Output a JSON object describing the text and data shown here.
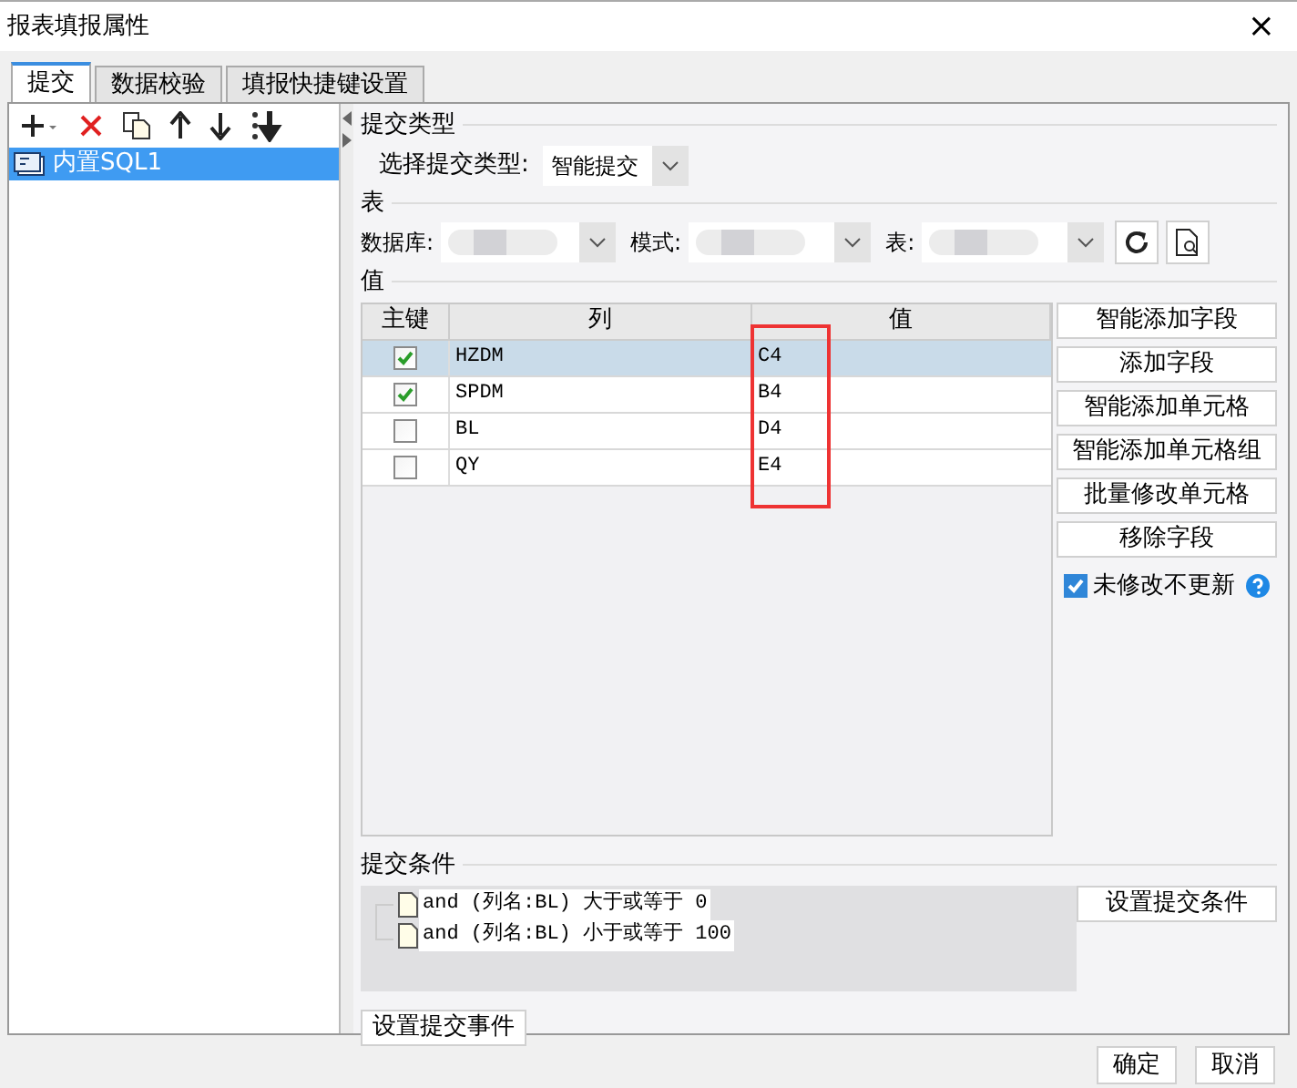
{
  "window": {
    "title": "报表填报属性",
    "close": "×"
  },
  "tabs": [
    {
      "label": "提交",
      "selected": true
    },
    {
      "label": "数据校验",
      "selected": false
    },
    {
      "label": "填报快捷键设置",
      "selected": false
    }
  ],
  "sidebar": {
    "items": [
      {
        "label": "内置SQL1",
        "selected": true
      }
    ]
  },
  "submit_type": {
    "heading": "提交类型",
    "label": "选择提交类型:",
    "value": "智能提交"
  },
  "table_section": {
    "heading": "表",
    "database_label": "数据库:",
    "schema_label": "模式:",
    "table_label": "表:"
  },
  "values": {
    "heading": "值",
    "columns": [
      "主键",
      "列",
      "值"
    ],
    "rows": [
      {
        "key": true,
        "column": "HZDM",
        "value": "C4",
        "selected": true
      },
      {
        "key": true,
        "column": "SPDM",
        "value": "B4",
        "selected": false
      },
      {
        "key": false,
        "column": "BL",
        "value": "D4",
        "selected": false
      },
      {
        "key": false,
        "column": "QY",
        "value": "E4",
        "selected": false
      }
    ],
    "buttons": [
      "智能添加字段",
      "添加字段",
      "智能添加单元格",
      "智能添加单元格组",
      "批量修改单元格",
      "移除字段"
    ],
    "no_update_unchanged": {
      "label": "未修改不更新",
      "checked": true
    }
  },
  "conditions": {
    "heading": "提交条件",
    "items": [
      "and (列名:BL) 大于或等于 0",
      "and (列名:BL) 小于或等于 100"
    ],
    "button": "设置提交条件"
  },
  "event_button": "设置提交事件",
  "footer_buttons": [
    "确定",
    "取消"
  ]
}
